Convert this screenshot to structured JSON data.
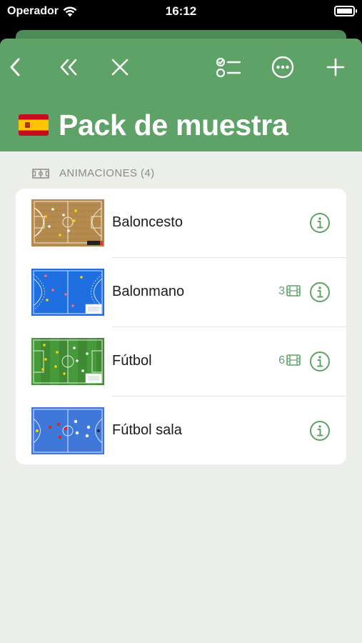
{
  "status_bar": {
    "carrier": "Operador",
    "time": "16:12"
  },
  "nav": {
    "icons": [
      "chevron-left-icon",
      "double-chevron-left-icon",
      "close-icon",
      "checklist-icon",
      "more-icon",
      "plus-icon"
    ]
  },
  "header": {
    "flag": "spain-flag",
    "title": "Pack de muestra"
  },
  "section": {
    "icon": "court-icon",
    "label": "ANIMACIONES (4)"
  },
  "items": [
    {
      "label": "Baloncesto",
      "count": "",
      "thumb": "basketball-court"
    },
    {
      "label": "Balonmano",
      "count": "3",
      "thumb": "handball-court"
    },
    {
      "label": "Fútbol",
      "count": "6",
      "thumb": "football-pitch"
    },
    {
      "label": "Fútbol sala",
      "count": "",
      "thumb": "futsal-court"
    }
  ],
  "colors": {
    "accent": "#5fa267",
    "header_dark": "#4e8a57",
    "background": "#ebeee9"
  }
}
